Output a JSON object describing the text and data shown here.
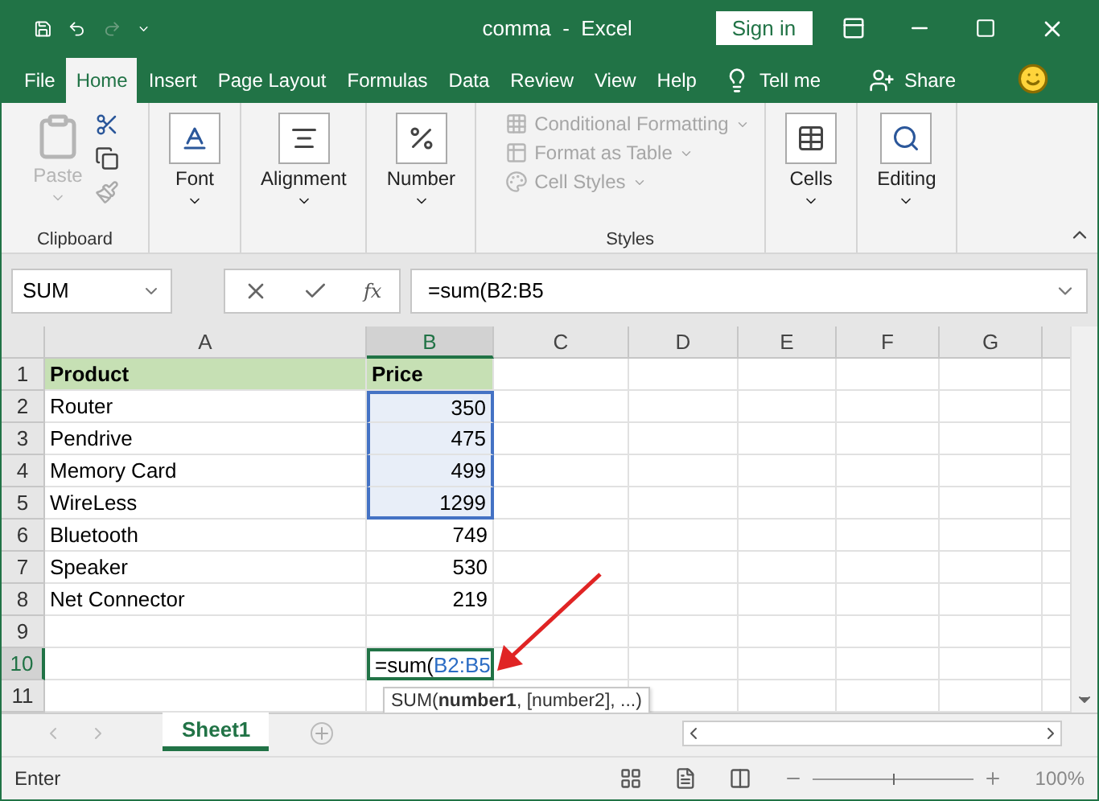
{
  "window": {
    "title": "comma  -  Excel",
    "sign_in": "Sign in"
  },
  "tabs": [
    {
      "label": "File",
      "selected": false
    },
    {
      "label": "Home",
      "selected": true
    },
    {
      "label": "Insert",
      "selected": false
    },
    {
      "label": "Page Layout",
      "selected": false
    },
    {
      "label": "Formulas",
      "selected": false
    },
    {
      "label": "Data",
      "selected": false
    },
    {
      "label": "Review",
      "selected": false
    },
    {
      "label": "View",
      "selected": false
    },
    {
      "label": "Help",
      "selected": false
    }
  ],
  "tell_me": "Tell me",
  "share": "Share",
  "ribbon": [
    {
      "kind": "clipboard",
      "label": "Clipboard",
      "paste": "Paste",
      "disabled": true
    },
    {
      "kind": "button",
      "label": "Font"
    },
    {
      "kind": "button",
      "label": "Alignment"
    },
    {
      "kind": "button",
      "label": "Number"
    },
    {
      "kind": "styles",
      "label": "Styles",
      "items": [
        {
          "label": "Conditional Formatting",
          "disabled": true
        },
        {
          "label": "Format as Table",
          "disabled": true
        },
        {
          "label": "Cell Styles",
          "disabled": true
        }
      ]
    },
    {
      "kind": "button",
      "label": "Cells"
    },
    {
      "kind": "button",
      "label": "Editing"
    }
  ],
  "formula_bar": {
    "name_box": "SUM",
    "function_button": "fx",
    "formula": "=sum(B2:B5"
  },
  "columns": [
    {
      "label": "A",
      "selected": false
    },
    {
      "label": "B",
      "selected": true
    },
    {
      "label": "C",
      "selected": false
    },
    {
      "label": "D",
      "selected": false
    },
    {
      "label": "E",
      "selected": false
    },
    {
      "label": "F",
      "selected": false
    },
    {
      "label": "G",
      "selected": false
    }
  ],
  "rows": [
    {
      "number": "1",
      "selected": false,
      "kind": "header",
      "cells": [
        "Product",
        "Price"
      ]
    },
    {
      "number": "2",
      "selected": false,
      "in_range": true,
      "cells": [
        "Router",
        "350"
      ]
    },
    {
      "number": "3",
      "selected": false,
      "in_range": true,
      "cells": [
        "Pendrive",
        "475"
      ]
    },
    {
      "number": "4",
      "selected": false,
      "in_range": true,
      "cells": [
        "Memory Card",
        "499"
      ]
    },
    {
      "number": "5",
      "selected": false,
      "in_range": true,
      "cells": [
        "WireLess",
        "1299"
      ]
    },
    {
      "number": "6",
      "selected": false,
      "cells": [
        "Bluetooth",
        "749"
      ]
    },
    {
      "number": "7",
      "selected": false,
      "cells": [
        "Speaker",
        "530"
      ]
    },
    {
      "number": "8",
      "selected": false,
      "cells": [
        "Net Connector",
        "219"
      ]
    },
    {
      "number": "9",
      "selected": false,
      "cells": []
    },
    {
      "number": "10",
      "selected": true,
      "kind": "editing",
      "cells": []
    },
    {
      "number": "11",
      "selected": false,
      "cells": []
    }
  ],
  "edit_cell": {
    "parts": [
      {
        "text": "=sum(",
        "kind": "plain"
      },
      {
        "text": "B2:B5",
        "kind": "reference"
      }
    ],
    "tooltip": "SUM(**number1**, [number2], ...)"
  },
  "sheets": [
    {
      "label": "Sheet1",
      "selected": true
    }
  ],
  "status_bar": {
    "mode": "Enter",
    "zoom": "100%",
    "level": 0.5
  }
}
